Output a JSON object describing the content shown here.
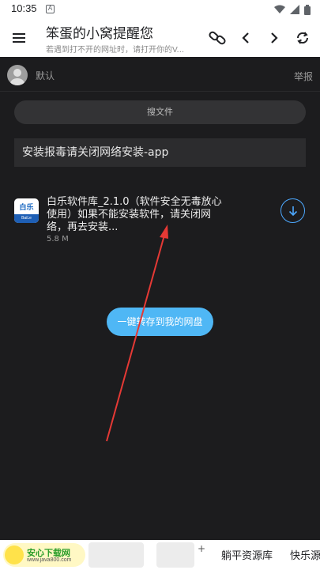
{
  "status_bar": {
    "time": "10:35",
    "notification_badge": "A",
    "icons": [
      "wifi-icon",
      "signal-icon",
      "battery-icon"
    ]
  },
  "app_bar": {
    "title": "笨蛋的小窝提醒您",
    "subtitle": "若遇到打不开的网址时，请打开你的V...",
    "icons": [
      "menu-icon",
      "link-icon",
      "back-icon",
      "forward-icon",
      "refresh-icon"
    ]
  },
  "user": {
    "name": "默认",
    "report_label": "举报"
  },
  "search": {
    "label": "搜文件"
  },
  "notice": {
    "text": "安装报毒请关闭网络安装-app"
  },
  "file": {
    "name": "白乐软件库_2.1.0（软件安全无毒放心使用）如果不能安装软件，请关闭网络，再去安装...",
    "size": "5.8 M",
    "thumb_text": "白乐",
    "thumb_caption": "BaiLe Ruanjian"
  },
  "save_button": {
    "label": "一键转存到我的网盘"
  },
  "bottom_bar": {
    "site_name": "安心下载网",
    "site_url": "www.java800.com",
    "tabs": [
      "躺平资源库",
      "快乐源"
    ]
  },
  "colors": {
    "background": "#1c1c1e",
    "accent": "#4fb7f5",
    "download_ring": "#4da9ff",
    "arrow": "#e53935"
  }
}
